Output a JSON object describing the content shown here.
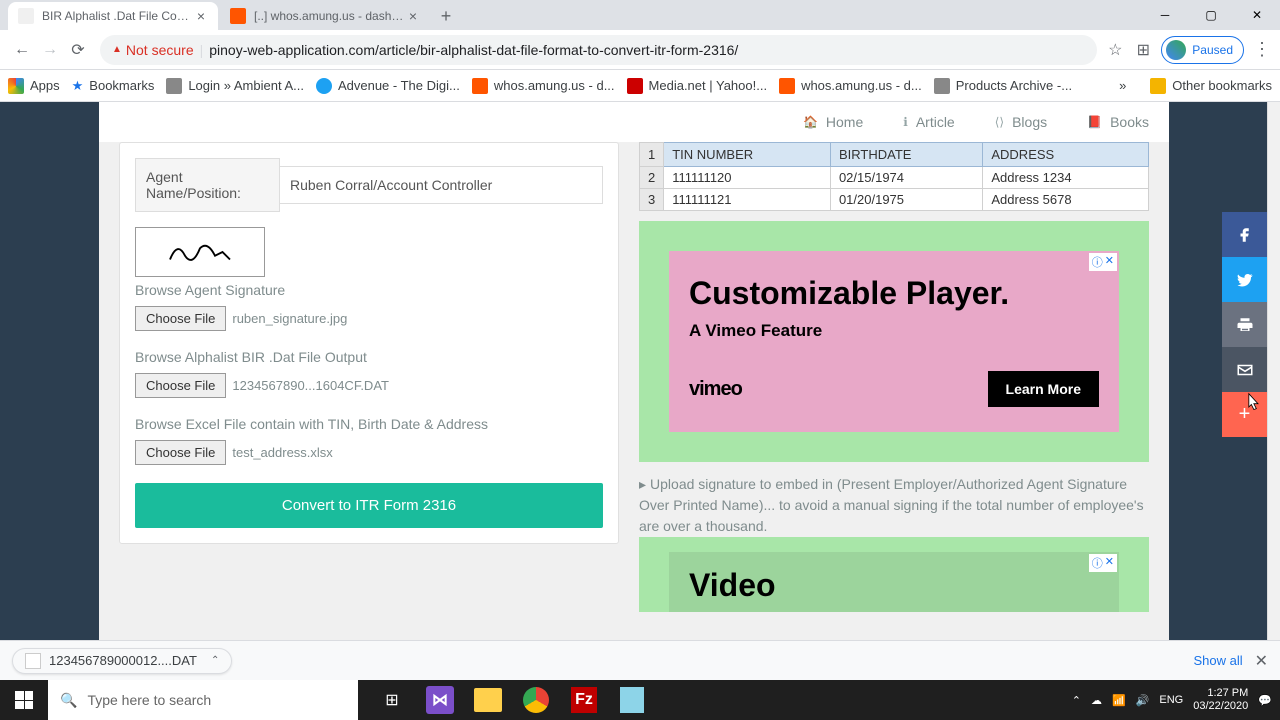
{
  "window": {
    "tabs": [
      {
        "title": "BIR Alphalist .Dat File Conversion",
        "active": true,
        "favicon_bg": "#f0f0f0"
      },
      {
        "title": "[..] whos.amung.us - dashboard",
        "active": false,
        "favicon_bg": "#ff5500"
      }
    ],
    "profile_status": "Paused"
  },
  "addressbar": {
    "security": "Not secure",
    "url": "pinoy-web-application.com/article/bir-alphalist-dat-file-format-to-convert-itr-form-2316/"
  },
  "bookmarks": {
    "apps": "Apps",
    "bookmarks": "Bookmarks",
    "items": [
      {
        "label": "Login » Ambient A...",
        "color": "#888888"
      },
      {
        "label": "Advenue - The Digi...",
        "color": "#1da1f2"
      },
      {
        "label": "whos.amung.us - d...",
        "color": "#ff5500"
      },
      {
        "label": "Media.net | Yahoo!...",
        "color": "#cc0000"
      },
      {
        "label": "whos.amung.us - d...",
        "color": "#ff5500"
      },
      {
        "label": "Products Archive -...",
        "color": "#888888"
      }
    ],
    "other": "Other bookmarks"
  },
  "site_nav": {
    "home": "Home",
    "article": "Article",
    "blogs": "Blogs",
    "books": "Books"
  },
  "form": {
    "agent_label": "Agent Name/Position:",
    "agent_value": "Ruben Corral/Account Controller",
    "sig_label": "Browse Agent Signature",
    "sig_file": "ruben_signature.jpg",
    "dat_label": "Browse Alphalist BIR .Dat File Output",
    "dat_file": "1234567890...1604CF.DAT",
    "xls_label": "Browse Excel File contain with TIN, Birth Date & Address",
    "xls_file": "test_address.xlsx",
    "choose_btn": "Choose File",
    "convert_btn": "Convert to ITR Form 2316"
  },
  "excel": {
    "headers": [
      "TIN NUMBER",
      "BIRTHDATE",
      "ADDRESS"
    ],
    "rows": [
      {
        "n": "1"
      },
      {
        "n": "2",
        "tin": "111111120",
        "bd": "02/15/1974",
        "addr": "Address 1234"
      },
      {
        "n": "3",
        "tin": "111111121",
        "bd": "01/20/1975",
        "addr": "Address 5678"
      }
    ]
  },
  "ad1": {
    "title": "Customizable Player.",
    "subtitle": "A Vimeo Feature",
    "brand": "vimeo",
    "cta": "Learn More"
  },
  "note": "Upload signature to embed in (Present Employer/Authorized Agent Signature Over Printed Name)... to avoid a manual signing if the total number of employee's are over a thousand.",
  "ad2": {
    "title": "Video"
  },
  "download": {
    "file": "123456789000012....DAT",
    "show_all": "Show all"
  },
  "taskbar": {
    "search_placeholder": "Type here to search",
    "lang": "ENG",
    "time": "1:27 PM",
    "date": "03/22/2020"
  }
}
